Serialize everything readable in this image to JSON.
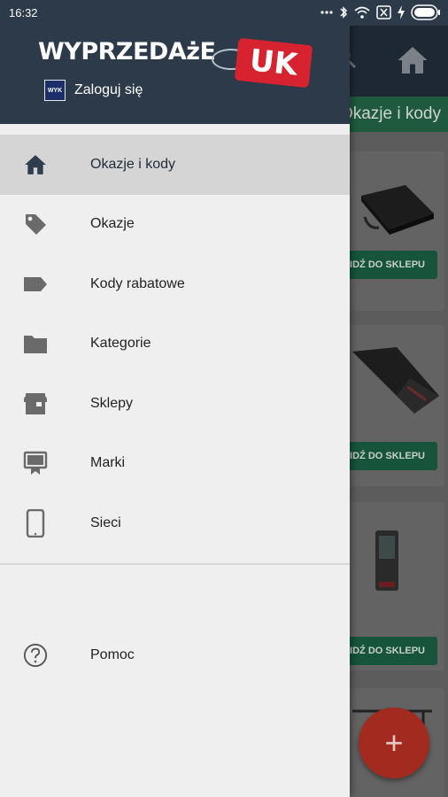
{
  "status_bar": {
    "time": "16:32",
    "icons": [
      "dots-icon",
      "bluetooth-icon",
      "wifi-icon",
      "sim-x-icon",
      "charging-icon",
      "battery-icon"
    ]
  },
  "background": {
    "tab_label": "Okazje i kody",
    "shop_button_label": "IDŹ DO SKLEPU",
    "fab_label": "+"
  },
  "drawer": {
    "logo_text": "WYPRZEDAżE",
    "logo_badge": "UK",
    "avatar_text": "WYK",
    "login_label": "Zaloguj się",
    "items": [
      {
        "label": "Okazje i kody",
        "icon": "home-icon",
        "active": true
      },
      {
        "label": "Okazje",
        "icon": "tag-icon",
        "active": false
      },
      {
        "label": "Kody rabatowe",
        "icon": "label-icon",
        "active": false
      },
      {
        "label": "Kategorie",
        "icon": "folder-icon",
        "active": false
      },
      {
        "label": "Sklepy",
        "icon": "store-icon",
        "active": false
      },
      {
        "label": "Marki",
        "icon": "brand-icon",
        "active": false
      },
      {
        "label": "Sieci",
        "icon": "phone-icon",
        "active": false
      }
    ],
    "help_label": "Pomoc"
  },
  "colors": {
    "header_bg": "#2c3a4a",
    "drawer_bg": "#efefef",
    "active_item_bg": "#d5d5d5",
    "accent_green": "#16543b",
    "fab_red": "#a32a1f",
    "logo_red": "#d6232f"
  }
}
